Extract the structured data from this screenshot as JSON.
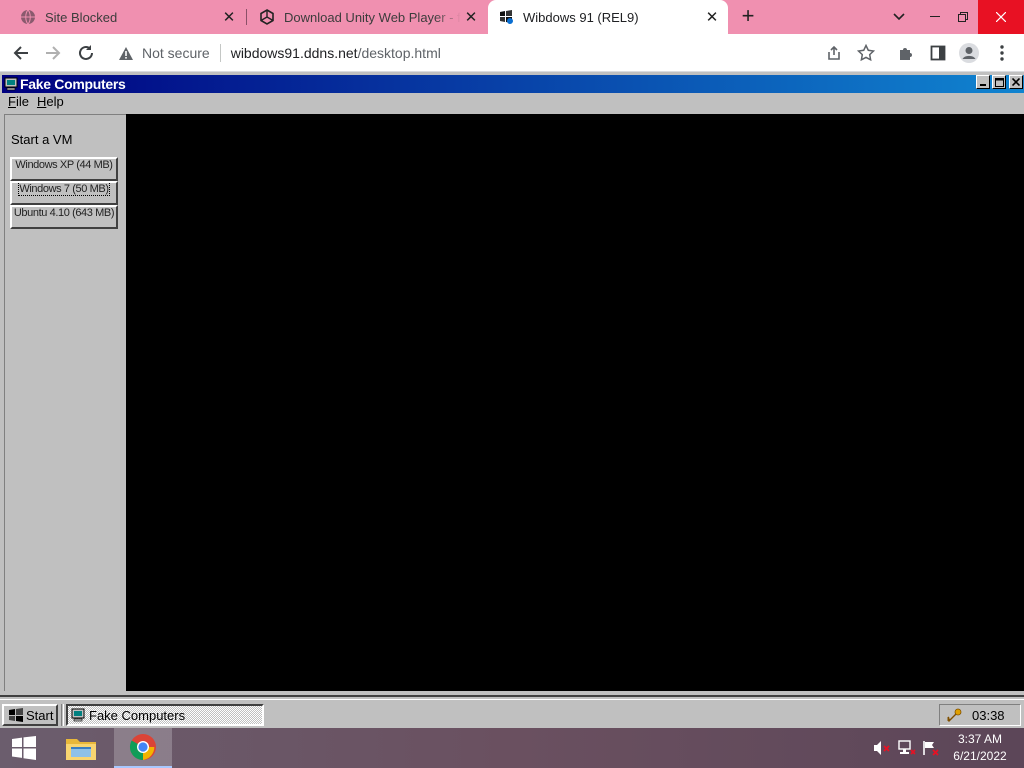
{
  "browser": {
    "tabs": [
      {
        "title": "Site Blocked",
        "icon": "globe-icon",
        "active": false
      },
      {
        "title": "Download Unity Web Player - fre",
        "icon": "unity-icon",
        "active": false
      },
      {
        "title": "Wibdows 91 (REL9)",
        "icon": "wibdows-icon",
        "active": true
      }
    ],
    "new_tab_label": "+",
    "security_label": "Not secure",
    "url_host": "wibdows91.ddns.net",
    "url_path": "/desktop.html"
  },
  "app": {
    "title": "Fake Computers",
    "menu": {
      "file": "F",
      "file_rest": "ile",
      "help": "H",
      "help_rest": "elp"
    },
    "sidebar": {
      "heading": "Start a VM",
      "vms": [
        {
          "label": "Windows XP (44 MB)"
        },
        {
          "label": "Windows 7 (50 MB)"
        },
        {
          "label": "Ubuntu 4.10 (643 MB)"
        }
      ]
    }
  },
  "w98_taskbar": {
    "start_label": "Start",
    "task_label": "Fake Computers",
    "clock": "03:38"
  },
  "w10_taskbar": {
    "time": "3:37 AM",
    "date": "6/21/2022"
  },
  "colors": {
    "tab_strip": "#f090b0",
    "titlebar_start": "#000080",
    "titlebar_end": "#1084d0",
    "win98_face": "#c0c0c0",
    "close_red": "#e81123"
  }
}
